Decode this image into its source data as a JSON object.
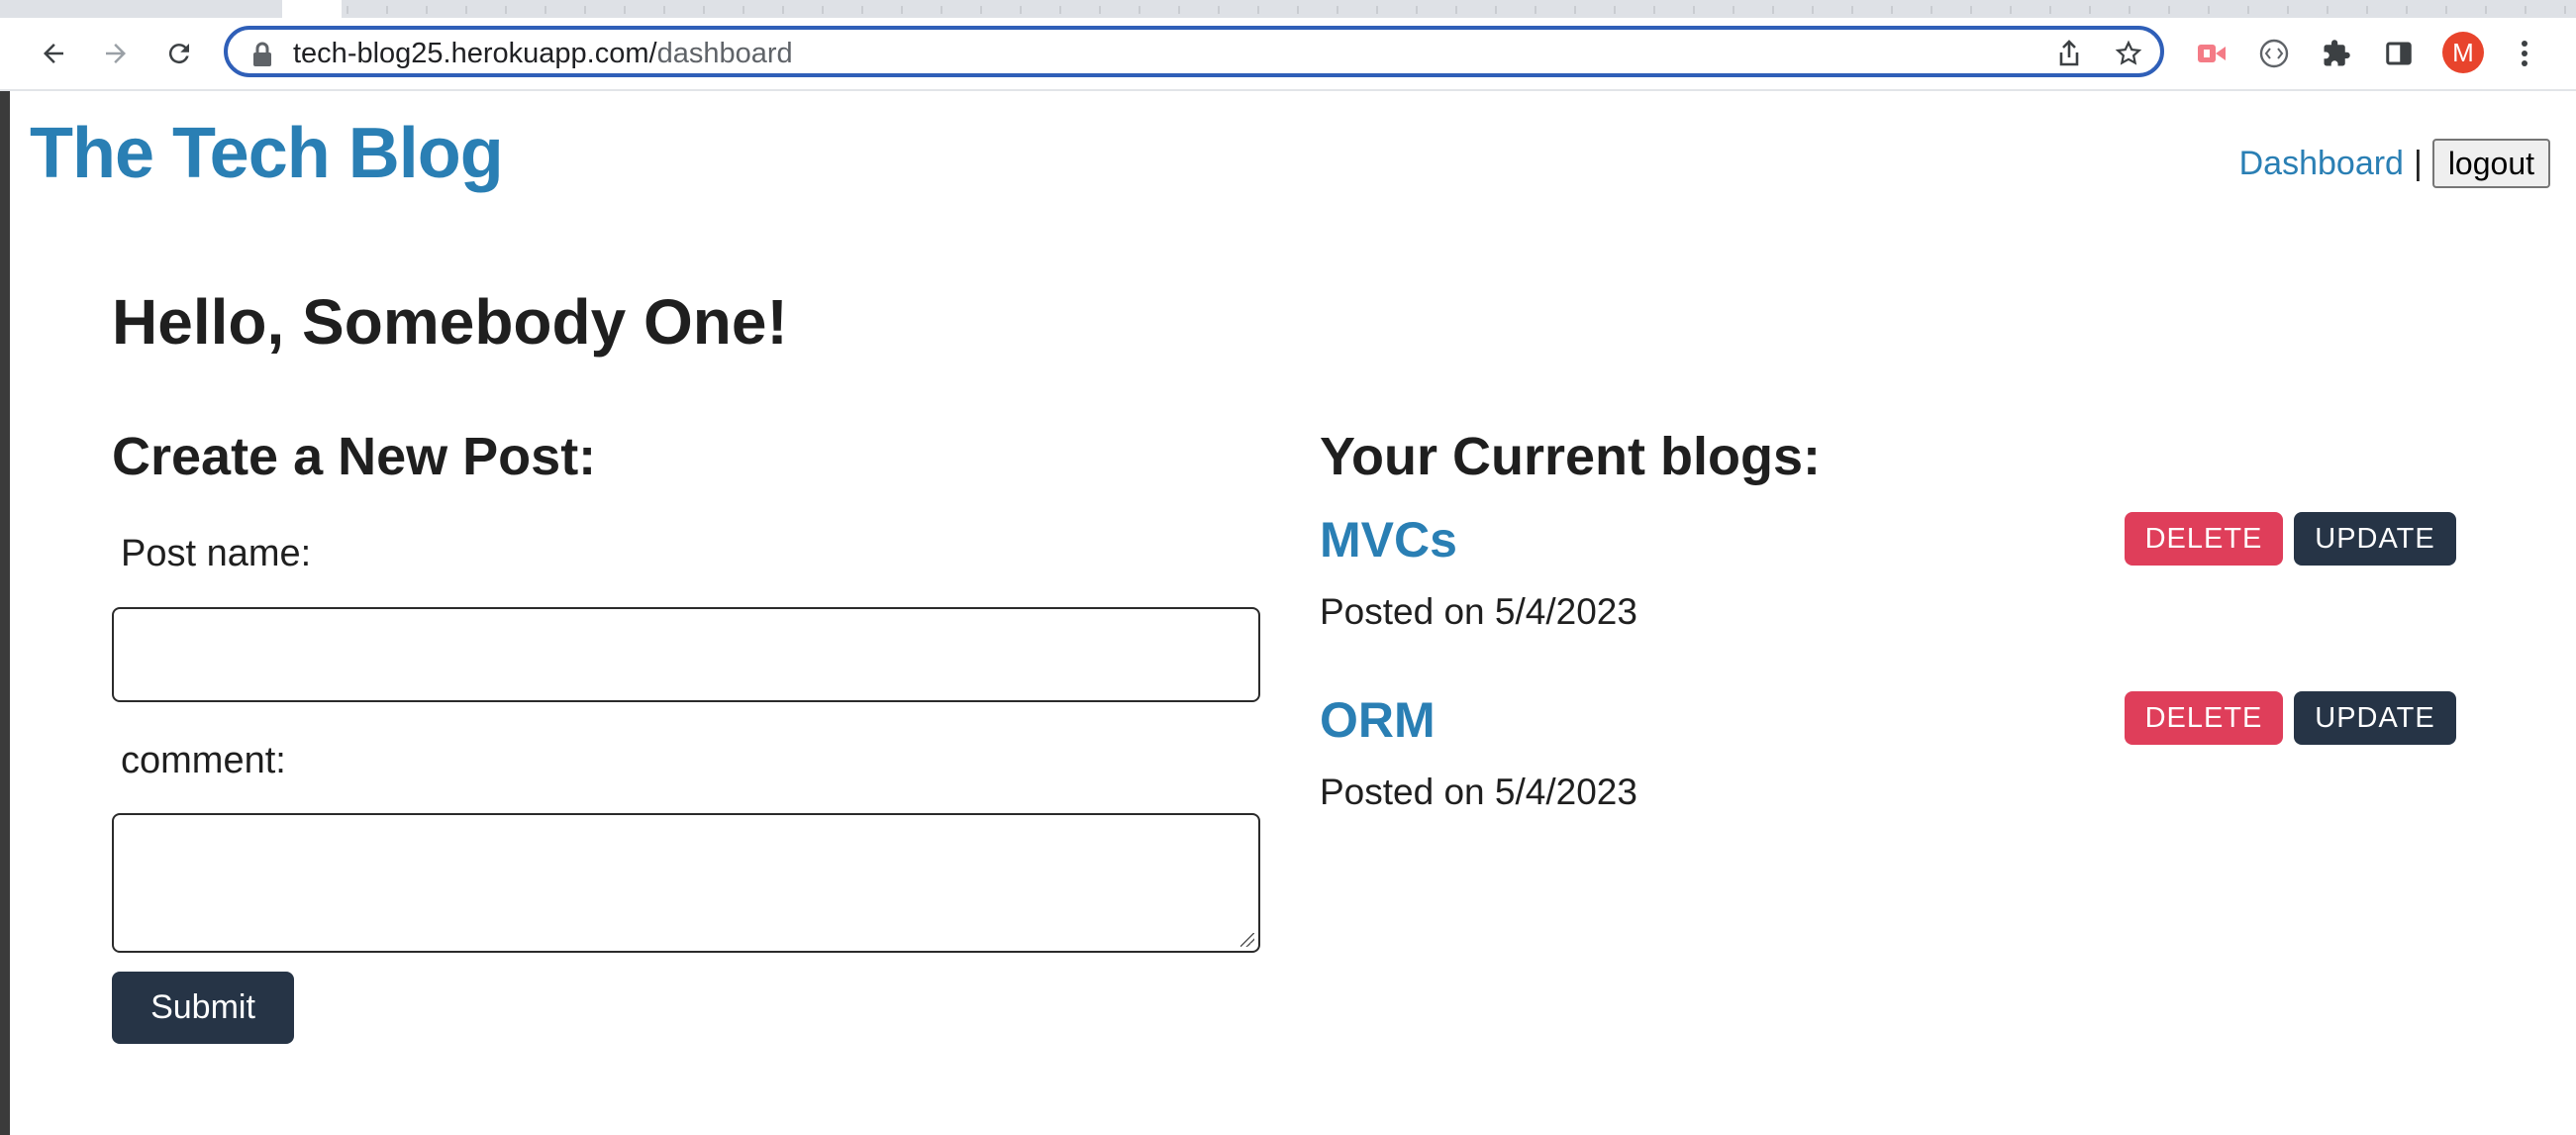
{
  "browser": {
    "url_host": "tech-blog25.herokuapp.com/",
    "url_path": "dashboard",
    "profile_initial": "M",
    "icons": [
      "back-arrow-icon",
      "forward-arrow-icon",
      "reload-icon",
      "lock-icon",
      "share-icon",
      "star-icon",
      "screencast-extension-icon",
      "code-extension-icon",
      "puzzle-extensions-icon",
      "side-panel-icon",
      "kebab-menu-icon"
    ],
    "colors": {
      "omnibox_border": "#2f5fb8",
      "avatar": "#e8442c"
    }
  },
  "site": {
    "title": "The Tech Blog",
    "nav": {
      "dashboard_label": "Dashboard",
      "separator": "|",
      "logout_label": "logout"
    }
  },
  "dashboard": {
    "greeting": "Hello, Somebody One!",
    "create": {
      "heading": "Create a New Post:",
      "post_name_label": "Post name:",
      "post_name_value": "",
      "comment_label": "comment:",
      "comment_value": "",
      "submit_label": "Submit"
    },
    "blogs": {
      "heading": "Your Current blogs:",
      "posts": [
        {
          "title": "MVCs",
          "date_text": "Posted on 5/4/2023",
          "delete_label": "DELETE",
          "update_label": "UPDATE"
        },
        {
          "title": "ORM",
          "date_text": "Posted on 5/4/2023",
          "delete_label": "DELETE",
          "update_label": "UPDATE"
        }
      ]
    }
  },
  "colors": {
    "brand_blue": "#2a7fb4",
    "delete_red": "#df3e5a",
    "dark_button": "#263446"
  }
}
